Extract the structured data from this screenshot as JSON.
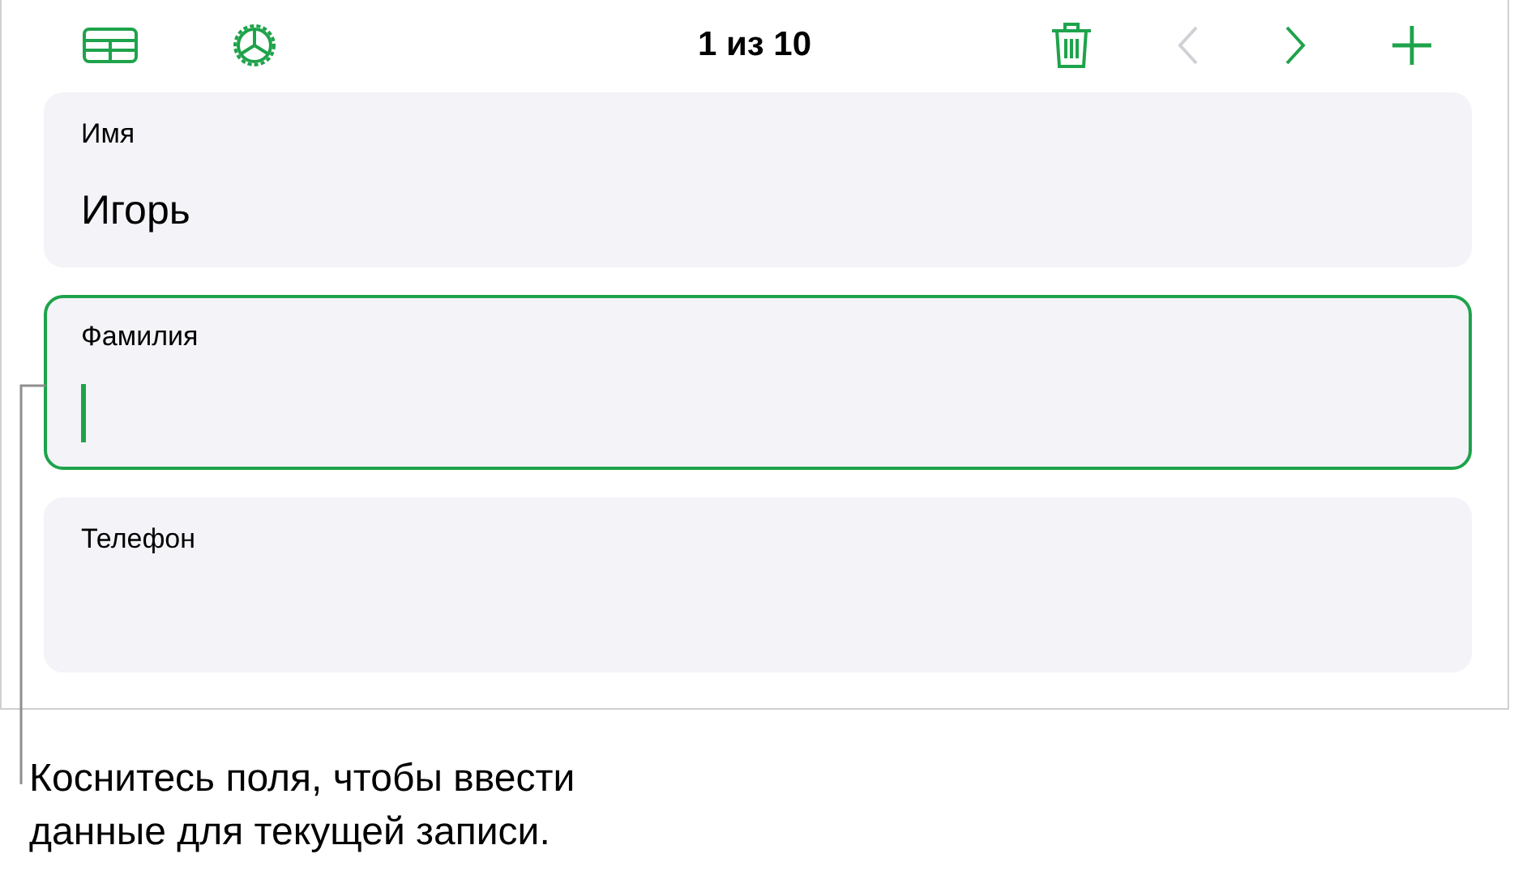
{
  "toolbar": {
    "record_counter": "1 из 10",
    "buttons": [
      {
        "kind": "table",
        "disabled": false
      },
      {
        "kind": "settings",
        "disabled": false
      },
      {
        "kind": "delete",
        "disabled": false
      },
      {
        "kind": "previous",
        "disabled": true
      },
      {
        "kind": "next",
        "disabled": false
      },
      {
        "kind": "add",
        "disabled": false
      }
    ]
  },
  "fields": [
    {
      "label": "Имя",
      "value": "Игорь",
      "focused": false
    },
    {
      "label": "Фамилия",
      "focused": true
    },
    {
      "label": "Телефон",
      "focused": false
    }
  ],
  "callout": "Коснитесь поля, чтобы ввести данные для текущей записи."
}
